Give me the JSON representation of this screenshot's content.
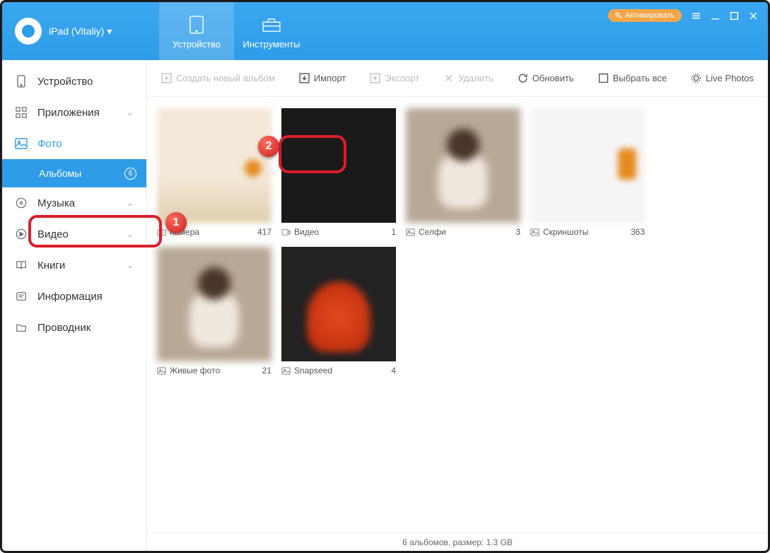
{
  "header": {
    "device_label": "iPad (Vitaliy)",
    "activate_label": "Активировать",
    "tabs": {
      "device": "Устройство",
      "tools": "Инструменты"
    }
  },
  "sidebar": {
    "device": "Устройство",
    "apps": "Приложения",
    "photo": "Фото",
    "albums": "Альбомы",
    "albums_count": "6",
    "music": "Музыка",
    "video": "Видео",
    "books": "Книги",
    "info": "Информация",
    "explorer": "Проводник"
  },
  "toolbar": {
    "new_album": "Создать новый альбом",
    "import": "Импорт",
    "export": "Экспорт",
    "delete": "Удалить",
    "refresh": "Обновить",
    "select_all": "Выбрать все",
    "live_photos": "Live Photos"
  },
  "albums": [
    {
      "name": "Камера",
      "count": "417",
      "icon": "camera"
    },
    {
      "name": "Видео",
      "count": "1",
      "icon": "video"
    },
    {
      "name": "Селфи",
      "count": "3",
      "icon": "image"
    },
    {
      "name": "Скриншоты",
      "count": "363",
      "icon": "image"
    },
    {
      "name": "Живые фото",
      "count": "21",
      "icon": "image"
    },
    {
      "name": "Snapseed",
      "count": "4",
      "icon": "image"
    }
  ],
  "status": "6 альбомов, размер: 1.3 GB",
  "callouts": {
    "one": "1",
    "two": "2"
  }
}
